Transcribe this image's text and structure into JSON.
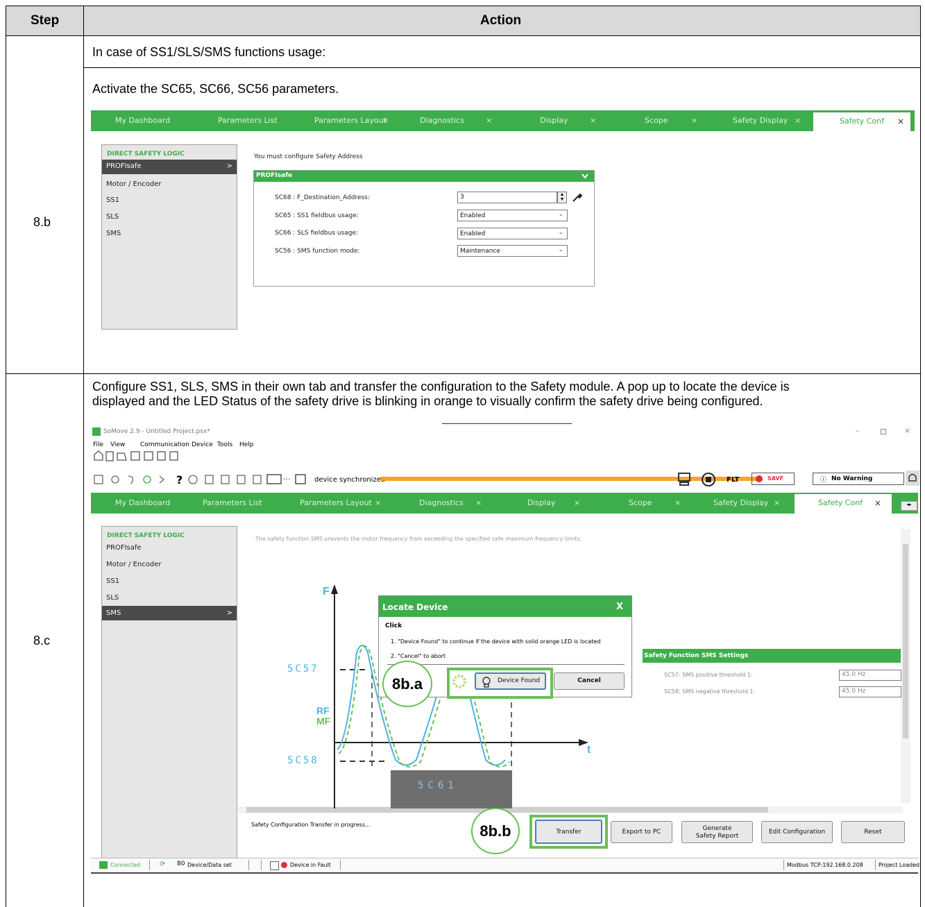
{
  "table": {
    "headers": {
      "step": "Step",
      "action": "Action"
    },
    "rows": [
      {
        "step": "8.b",
        "intro": "In case of SS1/SLS/SMS functions usage:",
        "text": "Activate the SC65, SC66, SC56 parameters.",
        "screen": {
          "tabs": [
            "My Dashboard",
            "Parameters List",
            "Parameters Layout",
            "Diagnostics",
            "Display",
            "Scope",
            "Safety Display",
            "Safety Conf"
          ],
          "tab_close": "×",
          "menu_header": "DIRECT SAFETY LOGIC",
          "menu_items": [
            "PROFIsafe",
            "Motor / Encoder",
            "SS1",
            "SLS",
            "SMS"
          ],
          "menu_selected_arrow": ">",
          "notice": "You must configure Safety Address",
          "panel_title": "PROFIsafe",
          "params": [
            {
              "label": "SC68 : F_Destination_Address:",
              "value": "3"
            },
            {
              "label": "SC65 : SS1 fieldbus usage:",
              "value": "Enabled"
            },
            {
              "label": "SC66 : SLS fieldbus usage:",
              "value": "Enabled"
            },
            {
              "label": "SC56 : SMS function mode:",
              "value": "Maintenance"
            }
          ]
        }
      },
      {
        "step": "8.c",
        "text1": "Configure SS1, SLS, SMS in their own tab and transfer the configuration to the Safety module. A pop up to locate the device is",
        "text2": "displayed and the LED Status of the safety drive is blinking in orange to visually confirm the safety drive being configured.",
        "screen": {
          "window_title": "SoMove 2.9 - Untitled Project.psx*",
          "menu": [
            "File",
            "View",
            "Communication",
            "Device",
            "Tools",
            "Help"
          ],
          "status_sync": "device synchronized",
          "flt": "FLT",
          "savf": "SAVF",
          "warning": "No Warning",
          "description": "The safety function SMS prevents the motor frequency from exceeding the specified safe maximum frequency limits.",
          "graph": {
            "f": "F",
            "t": "t",
            "rf": "RF",
            "mf": "MF",
            "sc57": "5C57",
            "sc58": "5C58",
            "sc61": "5C61"
          },
          "dialog": {
            "title": "Locate Device",
            "close": "X",
            "click": "Click",
            "line1": "1. \"Device Found\" to continue if the device with solid orange LED is located",
            "line2": "2. \"Cancel\" to abort",
            "found": "Device Found",
            "cancel": "Cancel"
          },
          "settings": {
            "title": "Safety Function SMS Settings",
            "rows": [
              {
                "label": "SC57: SMS positive threshold 1:",
                "value": "45.0 Hz"
              },
              {
                "label": "SC58: SMS negative threshold 1:",
                "value": "45.0 Hz"
              }
            ]
          },
          "transfer_status": "Safety Configuration Transfer in progress...",
          "buttons": {
            "transfer": "Transfer",
            "export": "Export to PC",
            "generate1": "Generate",
            "generate2": "Safety Report",
            "edit": "Edit Configuration",
            "reset": "Reset"
          },
          "callouts": {
            "a": "8b.a",
            "b": "8b.b"
          },
          "statusbar": {
            "connected": "Connected",
            "dataset": "Device/Data set",
            "fault": "Device in Fault",
            "modbus": "Modbus TCP:192.168.0.208",
            "loaded": "Project Loaded"
          }
        }
      }
    ]
  },
  "colors": {
    "accent_green": "#3dae4b",
    "callout_green": "#6bbf59",
    "header_gray": "#d9d9d9",
    "orange_bar": "#f5a623",
    "curve_blue": "#4ab3e6"
  }
}
